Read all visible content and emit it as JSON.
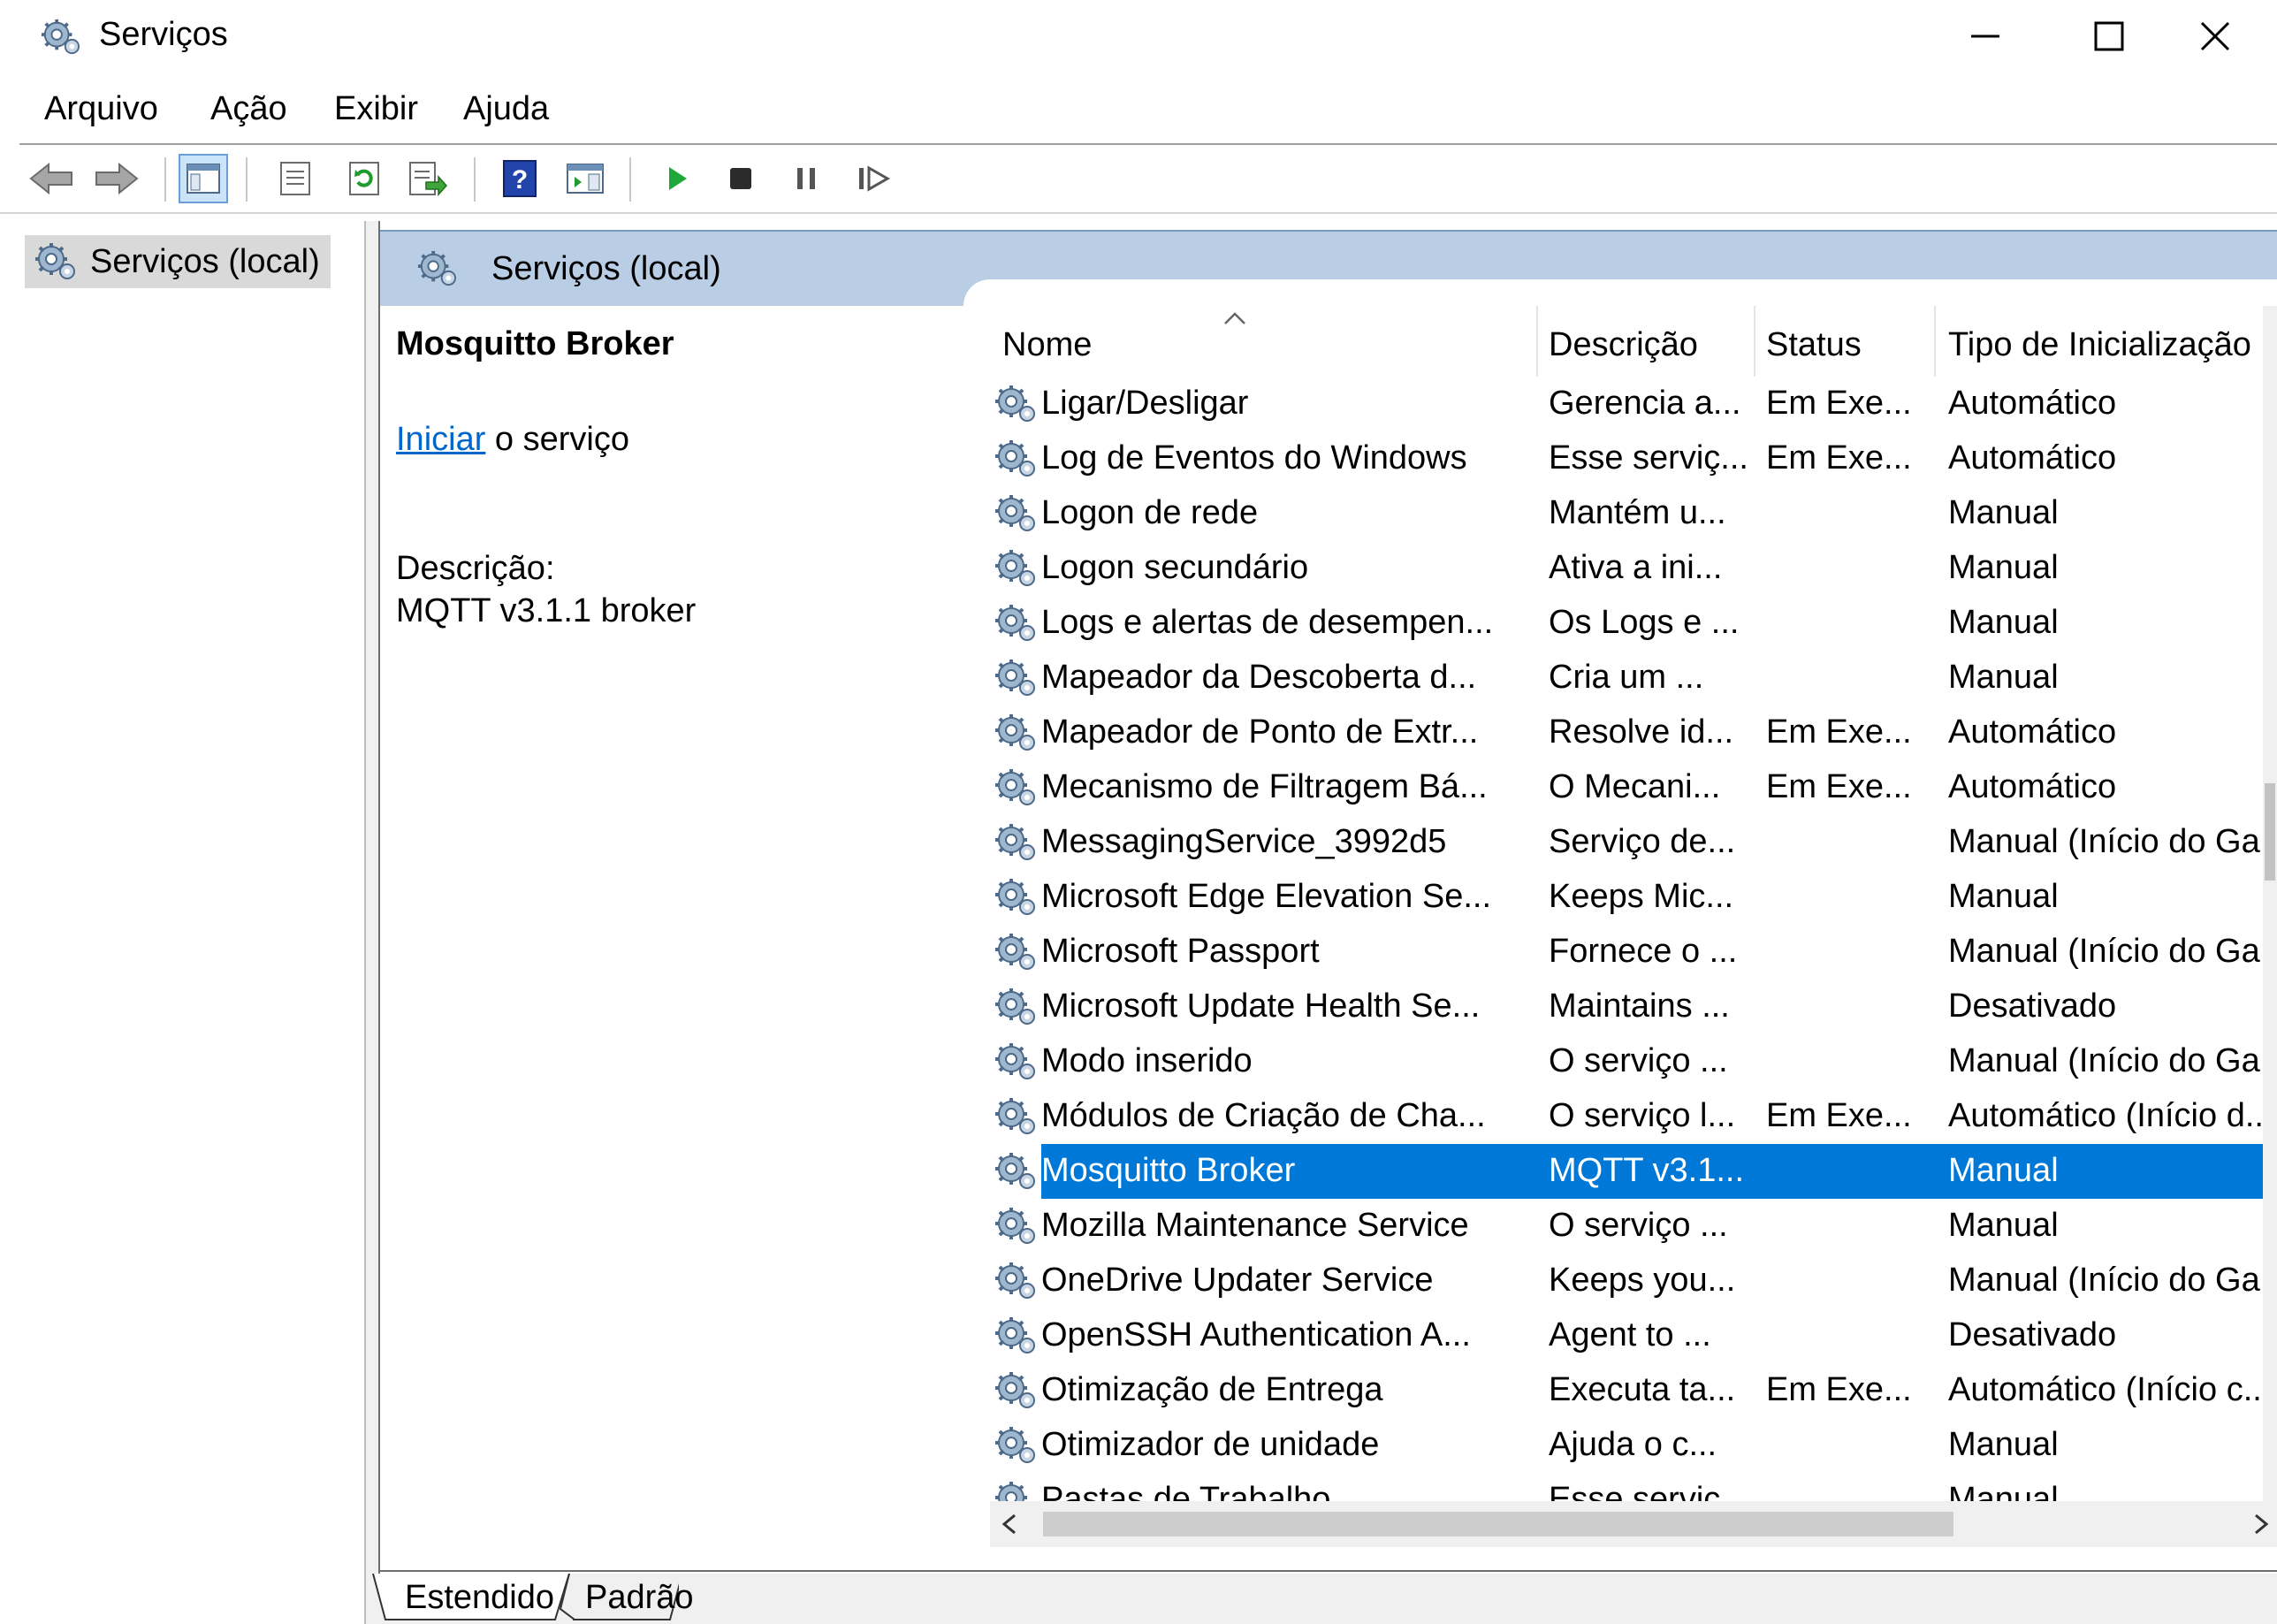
{
  "window": {
    "title": "Serviços",
    "icon": "gears-icon",
    "controls": [
      "minimize-icon",
      "maximize-icon",
      "close-icon"
    ]
  },
  "menu": [
    "Arquivo",
    "Ação",
    "Exibir",
    "Ajuda"
  ],
  "toolbar": {
    "icons": [
      "back-arrow-icon",
      "forward-arrow-icon",
      "show-hide-console-tree-icon",
      "properties-icon",
      "refresh-icon",
      "export-list-icon",
      "help-icon",
      "show-hide-action-pane-icon",
      "start-service-icon",
      "stop-service-icon",
      "pause-service-icon",
      "restart-service-icon"
    ]
  },
  "tree": {
    "item": "Serviços (local)"
  },
  "pane_header": {
    "title": "Serviços (local)"
  },
  "detail": {
    "service_name": "Mosquitto Broker",
    "action_link": "Iniciar",
    "action_text": " o serviço",
    "description_label": "Descrição:",
    "description_value": "MQTT v3.1.1 broker"
  },
  "columns": {
    "name": "Nome",
    "description": "Descrição",
    "status": "Status",
    "startup_type": "Tipo de Inicialização"
  },
  "services": [
    {
      "name": "Ligar/Desligar",
      "description": "Gerencia a...",
      "status": "Em Exe...",
      "startup": "Automático"
    },
    {
      "name": "Log de Eventos do Windows",
      "description": "Esse serviç...",
      "status": "Em Exe...",
      "startup": "Automático"
    },
    {
      "name": "Logon de rede",
      "description": "Mantém u...",
      "status": "",
      "startup": "Manual"
    },
    {
      "name": "Logon secundário",
      "description": "Ativa a ini...",
      "status": "",
      "startup": "Manual"
    },
    {
      "name": "Logs e alertas de desempen...",
      "description": "Os Logs e ...",
      "status": "",
      "startup": "Manual"
    },
    {
      "name": "Mapeador da Descoberta d...",
      "description": "Cria um ...",
      "status": "",
      "startup": "Manual"
    },
    {
      "name": "Mapeador de Ponto de Extr...",
      "description": "Resolve id...",
      "status": "Em Exe...",
      "startup": "Automático"
    },
    {
      "name": "Mecanismo de Filtragem Bá...",
      "description": "O Mecani...",
      "status": "Em Exe...",
      "startup": "Automático"
    },
    {
      "name": "MessagingService_3992d5",
      "description": "Serviço de...",
      "status": "",
      "startup": "Manual (Início do Ga..."
    },
    {
      "name": "Microsoft Edge Elevation Se...",
      "description": "Keeps Mic...",
      "status": "",
      "startup": "Manual"
    },
    {
      "name": "Microsoft Passport",
      "description": "Fornece o ...",
      "status": "",
      "startup": "Manual (Início do Ga..."
    },
    {
      "name": "Microsoft Update Health Se...",
      "description": "Maintains ...",
      "status": "",
      "startup": "Desativado"
    },
    {
      "name": "Modo inserido",
      "description": "O serviço ...",
      "status": "",
      "startup": "Manual (Início do Ga..."
    },
    {
      "name": "Módulos de Criação de Cha...",
      "description": "O serviço l...",
      "status": "Em Exe...",
      "startup": "Automático (Início d..."
    },
    {
      "name": "Mosquitto Broker",
      "description": "MQTT v3.1...",
      "status": "",
      "startup": "Manual",
      "selected": true
    },
    {
      "name": "Mozilla Maintenance Service",
      "description": "O serviço ...",
      "status": "",
      "startup": "Manual"
    },
    {
      "name": "OneDrive Updater Service",
      "description": "Keeps you...",
      "status": "",
      "startup": "Manual (Início do Ga..."
    },
    {
      "name": "OpenSSH Authentication A...",
      "description": "Agent to ...",
      "status": "",
      "startup": "Desativado"
    },
    {
      "name": "Otimização de Entrega",
      "description": "Executa ta...",
      "status": "Em Exe...",
      "startup": "Automático (Início c..."
    },
    {
      "name": "Otimizador de unidade",
      "description": "Ajuda o c...",
      "status": "",
      "startup": "Manual"
    },
    {
      "name": "Pastas de Trabalho",
      "description": "Esse serviç...",
      "status": "",
      "startup": "Manual"
    }
  ],
  "tabs": [
    "Estendido",
    "Padrão"
  ],
  "colors": {
    "selection": "#0078d7",
    "header_band": "#b9cde4",
    "link": "#0066cc"
  }
}
